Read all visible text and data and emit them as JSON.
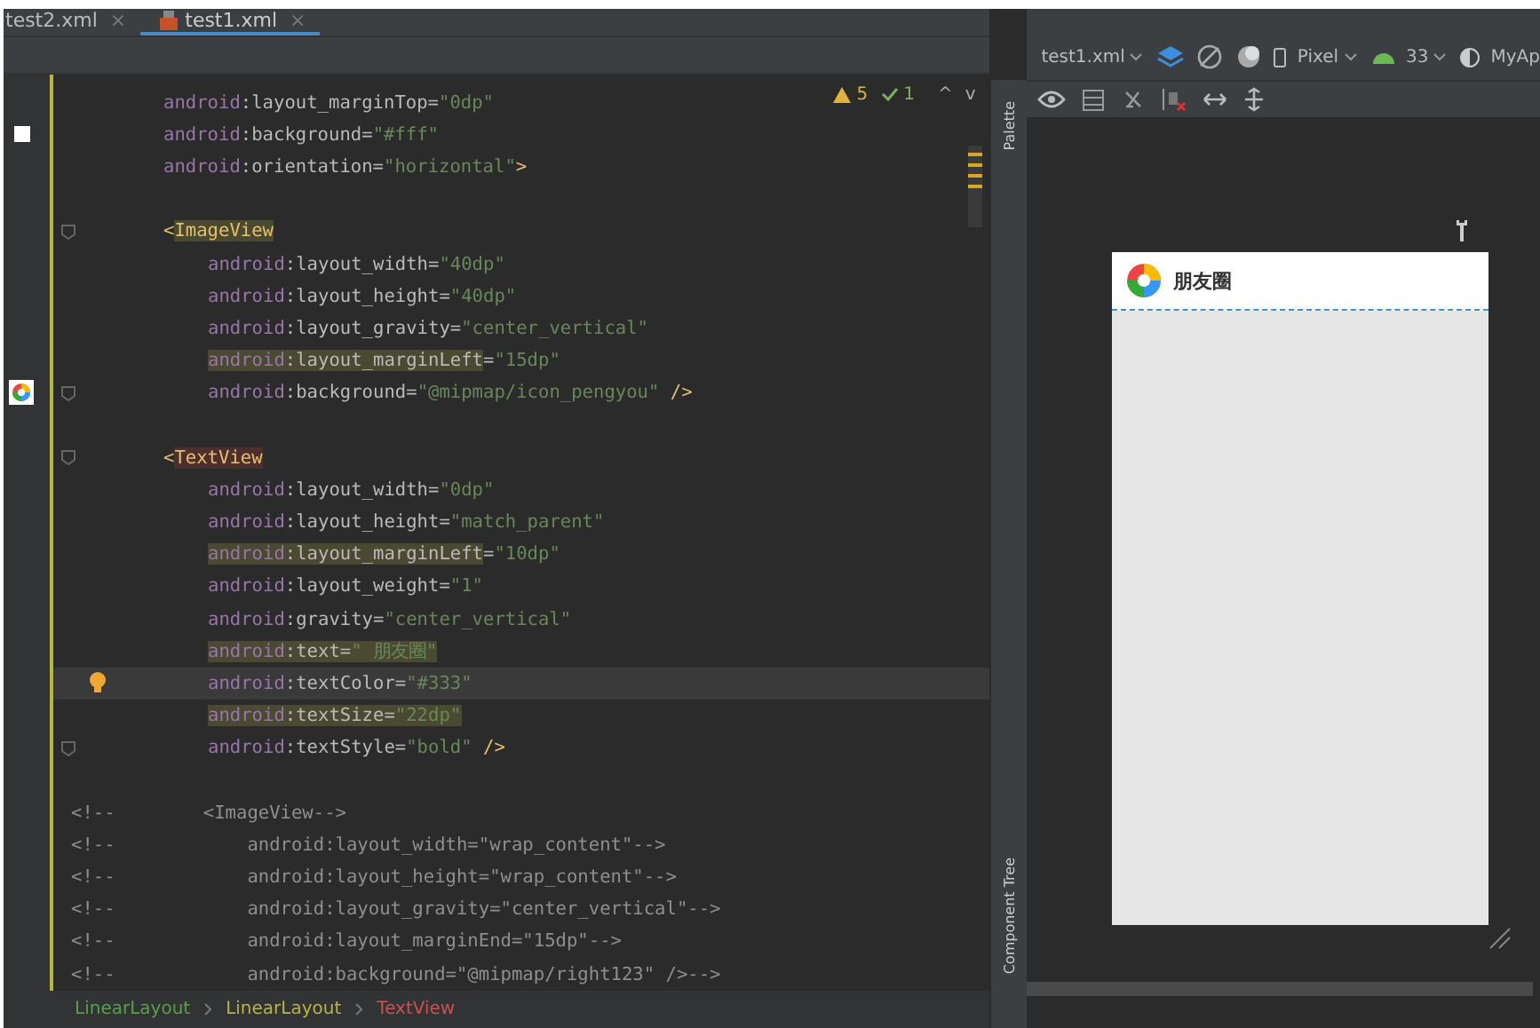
{
  "tabs": [
    {
      "label": "test2.xml",
      "close": "×",
      "selected": false
    },
    {
      "label": "test1.xml",
      "close": "×",
      "selected": true
    }
  ],
  "inspections": {
    "warnings": "5",
    "weak_warnings": "1",
    "up": "^",
    "down": "v"
  },
  "code_lines": [
    {
      "kind": "code",
      "current": false,
      "parts": [
        {
          "kind": "ns",
          "text": "android",
          "highlight": false
        },
        {
          "kind": "attr",
          "text": ":layout_marginTop=",
          "highlight": false
        },
        {
          "kind": "val",
          "text": "\"0dp\"",
          "highlight": false
        }
      ]
    },
    {
      "kind": "code",
      "current": false,
      "color_swatch": true,
      "parts": [
        {
          "kind": "ns",
          "text": "android",
          "highlight": false
        },
        {
          "kind": "attr",
          "text": ":background=",
          "highlight": false
        },
        {
          "kind": "val",
          "text": "\"#fff\"",
          "highlight": false
        }
      ]
    },
    {
      "kind": "code",
      "current": false,
      "parts": [
        {
          "kind": "ns",
          "text": "android",
          "highlight": false
        },
        {
          "kind": "attr",
          "text": ":orientation=",
          "highlight": false
        },
        {
          "kind": "val",
          "text": "\"horizontal\"",
          "highlight": false
        },
        {
          "kind": "tag",
          "text": ">",
          "highlight": false
        }
      ]
    },
    {
      "kind": "blank",
      "current": false
    },
    {
      "kind": "code",
      "current": false,
      "fold": true,
      "parts": [
        {
          "kind": "tag",
          "text": "<",
          "highlight": false
        },
        {
          "kind": "tagname",
          "text": "ImageView",
          "highlight": true
        }
      ],
      "children": [
        {
          "kind": "code",
          "current": false,
          "parts": [
            {
              "kind": "ns",
              "text": "android",
              "highlight": false
            },
            {
              "kind": "attr",
              "text": ":layout_width=",
              "highlight": false
            },
            {
              "kind": "val",
              "text": "\"40dp\"",
              "highlight": false
            }
          ]
        },
        {
          "kind": "code",
          "current": false,
          "parts": [
            {
              "kind": "ns",
              "text": "android",
              "highlight": false
            },
            {
              "kind": "attr",
              "text": ":layout_height=",
              "highlight": false
            },
            {
              "kind": "val",
              "text": "\"40dp\"",
              "highlight": false
            }
          ]
        },
        {
          "kind": "code",
          "current": false,
          "parts": [
            {
              "kind": "ns",
              "text": "android",
              "highlight": false
            },
            {
              "kind": "attr",
              "text": ":layout_gravity=",
              "highlight": false
            },
            {
              "kind": "val",
              "text": "\"center_vertical\"",
              "highlight": false
            }
          ]
        },
        {
          "kind": "code",
          "current": false,
          "parts": [
            {
              "kind": "ns",
              "text": "android",
              "highlight": true
            },
            {
              "kind": "attr",
              "text": ":layout_marginLeft",
              "highlight": true
            },
            {
              "kind": "attr",
              "text": "=",
              "highlight": false
            },
            {
              "kind": "val",
              "text": "\"15dp\"",
              "highlight": false
            }
          ]
        },
        {
          "kind": "code",
          "current": false,
          "image_preview": true,
          "fold": true,
          "parts": [
            {
              "kind": "ns",
              "text": "android",
              "highlight": false
            },
            {
              "kind": "attr",
              "text": ":background=",
              "highlight": false
            },
            {
              "kind": "val",
              "text": "\"@mipmap/icon_pengyou\"",
              "highlight": false
            },
            {
              "kind": "tag",
              "text": " />",
              "highlight": false
            }
          ]
        }
      ]
    },
    {
      "kind": "blank",
      "current": false
    },
    {
      "kind": "code",
      "current": false,
      "fold": true,
      "parts": [
        {
          "kind": "tag",
          "text": "<",
          "highlight": false
        },
        {
          "kind": "errtag",
          "text": "TextView",
          "highlight": true
        }
      ],
      "children": [
        {
          "kind": "code",
          "current": false,
          "parts": [
            {
              "kind": "ns",
              "text": "android",
              "highlight": false
            },
            {
              "kind": "attr",
              "text": ":layout_width=",
              "highlight": false
            },
            {
              "kind": "val",
              "text": "\"0dp\"",
              "highlight": false
            }
          ]
        },
        {
          "kind": "code",
          "current": false,
          "parts": [
            {
              "kind": "ns",
              "text": "android",
              "highlight": false
            },
            {
              "kind": "attr",
              "text": ":layout_height=",
              "highlight": false
            },
            {
              "kind": "val",
              "text": "\"match_parent\"",
              "highlight": false
            }
          ]
        },
        {
          "kind": "code",
          "current": false,
          "parts": [
            {
              "kind": "ns",
              "text": "android",
              "highlight": true
            },
            {
              "kind": "attr",
              "text": ":layout_marginLeft",
              "highlight": true
            },
            {
              "kind": "attr",
              "text": "=",
              "highlight": false
            },
            {
              "kind": "val",
              "text": "\"10dp\"",
              "highlight": false
            }
          ]
        },
        {
          "kind": "code",
          "current": false,
          "parts": [
            {
              "kind": "ns",
              "text": "android",
              "highlight": false
            },
            {
              "kind": "attr",
              "text": ":layout_weight=",
              "highlight": false
            },
            {
              "kind": "val",
              "text": "\"1\"",
              "highlight": false
            }
          ]
        },
        {
          "kind": "code",
          "current": false,
          "parts": [
            {
              "kind": "ns",
              "text": "android",
              "highlight": false
            },
            {
              "kind": "attr",
              "text": ":gravity=",
              "highlight": false
            },
            {
              "kind": "val",
              "text": "\"center_vertical\"",
              "highlight": false
            }
          ]
        },
        {
          "kind": "code",
          "current": false,
          "parts": [
            {
              "kind": "ns",
              "text": "android",
              "highlight": true
            },
            {
              "kind": "attr",
              "text": ":text=",
              "highlight": true
            },
            {
              "kind": "val",
              "text": "\" 朋友圈\"",
              "highlight": true
            }
          ]
        },
        {
          "kind": "code",
          "current": true,
          "lightbulb": true,
          "parts": [
            {
              "kind": "ns",
              "text": "android",
              "highlight": false
            },
            {
              "kind": "attr",
              "text": ":textColor=",
              "highlight": false
            },
            {
              "kind": "val",
              "text": "\"#333\"",
              "highlight": false
            }
          ]
        },
        {
          "kind": "code",
          "current": false,
          "parts": [
            {
              "kind": "ns",
              "text": "android",
              "highlight": true
            },
            {
              "kind": "attr",
              "text": ":textSize=",
              "highlight": true
            },
            {
              "kind": "val",
              "text": "\"22dp\"",
              "highlight": true
            }
          ]
        },
        {
          "kind": "code",
          "current": false,
          "fold": true,
          "parts": [
            {
              "kind": "ns",
              "text": "android",
              "highlight": false
            },
            {
              "kind": "attr",
              "text": ":textStyle=",
              "highlight": false
            },
            {
              "kind": "val",
              "text": "\"bold\"",
              "highlight": false
            },
            {
              "kind": "tag",
              "text": " />",
              "highlight": false
            }
          ]
        }
      ]
    },
    {
      "kind": "blank",
      "current": false
    },
    {
      "kind": "comment",
      "current": false,
      "text": "<!--        <ImageView-->"
    },
    {
      "kind": "comment",
      "current": false,
      "text": "<!--            android:layout_width=\"wrap_content\"-->"
    },
    {
      "kind": "comment",
      "current": false,
      "text": "<!--            android:layout_height=\"wrap_content\"-->"
    },
    {
      "kind": "comment",
      "current": false,
      "text": "<!--            android:layout_gravity=\"center_vertical\"-->"
    },
    {
      "kind": "comment",
      "current": false,
      "text": "<!--            android:layout_marginEnd=\"15dp\"-->"
    },
    {
      "kind": "comment",
      "current": false,
      "text": "<!--            android:background=\"@mipmap/right123\" />-->"
    }
  ],
  "breadcrumb": [
    {
      "label": "LinearLayout",
      "color": "#5a9e4b"
    },
    {
      "label": "LinearLayout",
      "color": "#b8b34a"
    },
    {
      "label": "TextView",
      "color": "#c75450"
    }
  ],
  "side_strip": {
    "palette": "Palette",
    "component_tree": "Component Tree"
  },
  "design_toolbar": {
    "file": "test1.xml",
    "device": "Pixel",
    "api": "33",
    "theme": "MyAp"
  },
  "preview": {
    "title": "朋友圈"
  }
}
